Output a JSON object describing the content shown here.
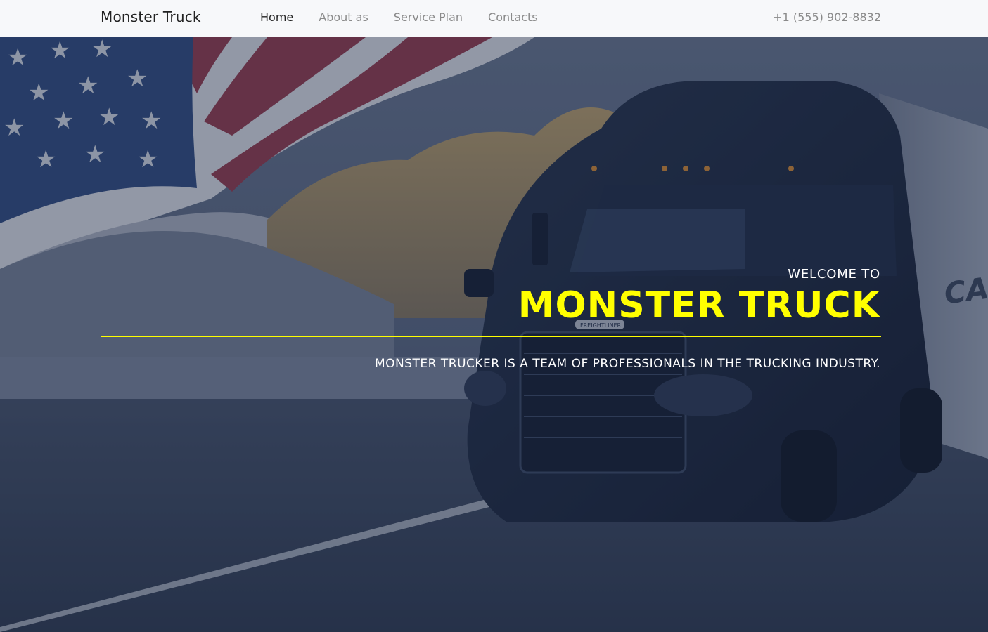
{
  "brand": {
    "name": "Monster Truck"
  },
  "nav": {
    "items": [
      {
        "label": "Home",
        "active": true
      },
      {
        "label": "About as",
        "active": false
      },
      {
        "label": "Service Plan",
        "active": false
      },
      {
        "label": "Contacts",
        "active": false
      }
    ],
    "phone": "+1 (555) 902-8832"
  },
  "hero": {
    "welcome": "WELCOME TO",
    "title": "MONSTER TRUCK",
    "tagline": "MONSTER TRUCKER IS A TEAM OF PROFESSIONALS IN THE TRUCKING INDUSTRY.",
    "truck_side_text": "CASCA",
    "grille_badge": "FREIGHTLINER"
  },
  "colors": {
    "accent": "#ffff00",
    "navbar_bg": "#f7f8fa",
    "overlay": "#1e2c48"
  }
}
